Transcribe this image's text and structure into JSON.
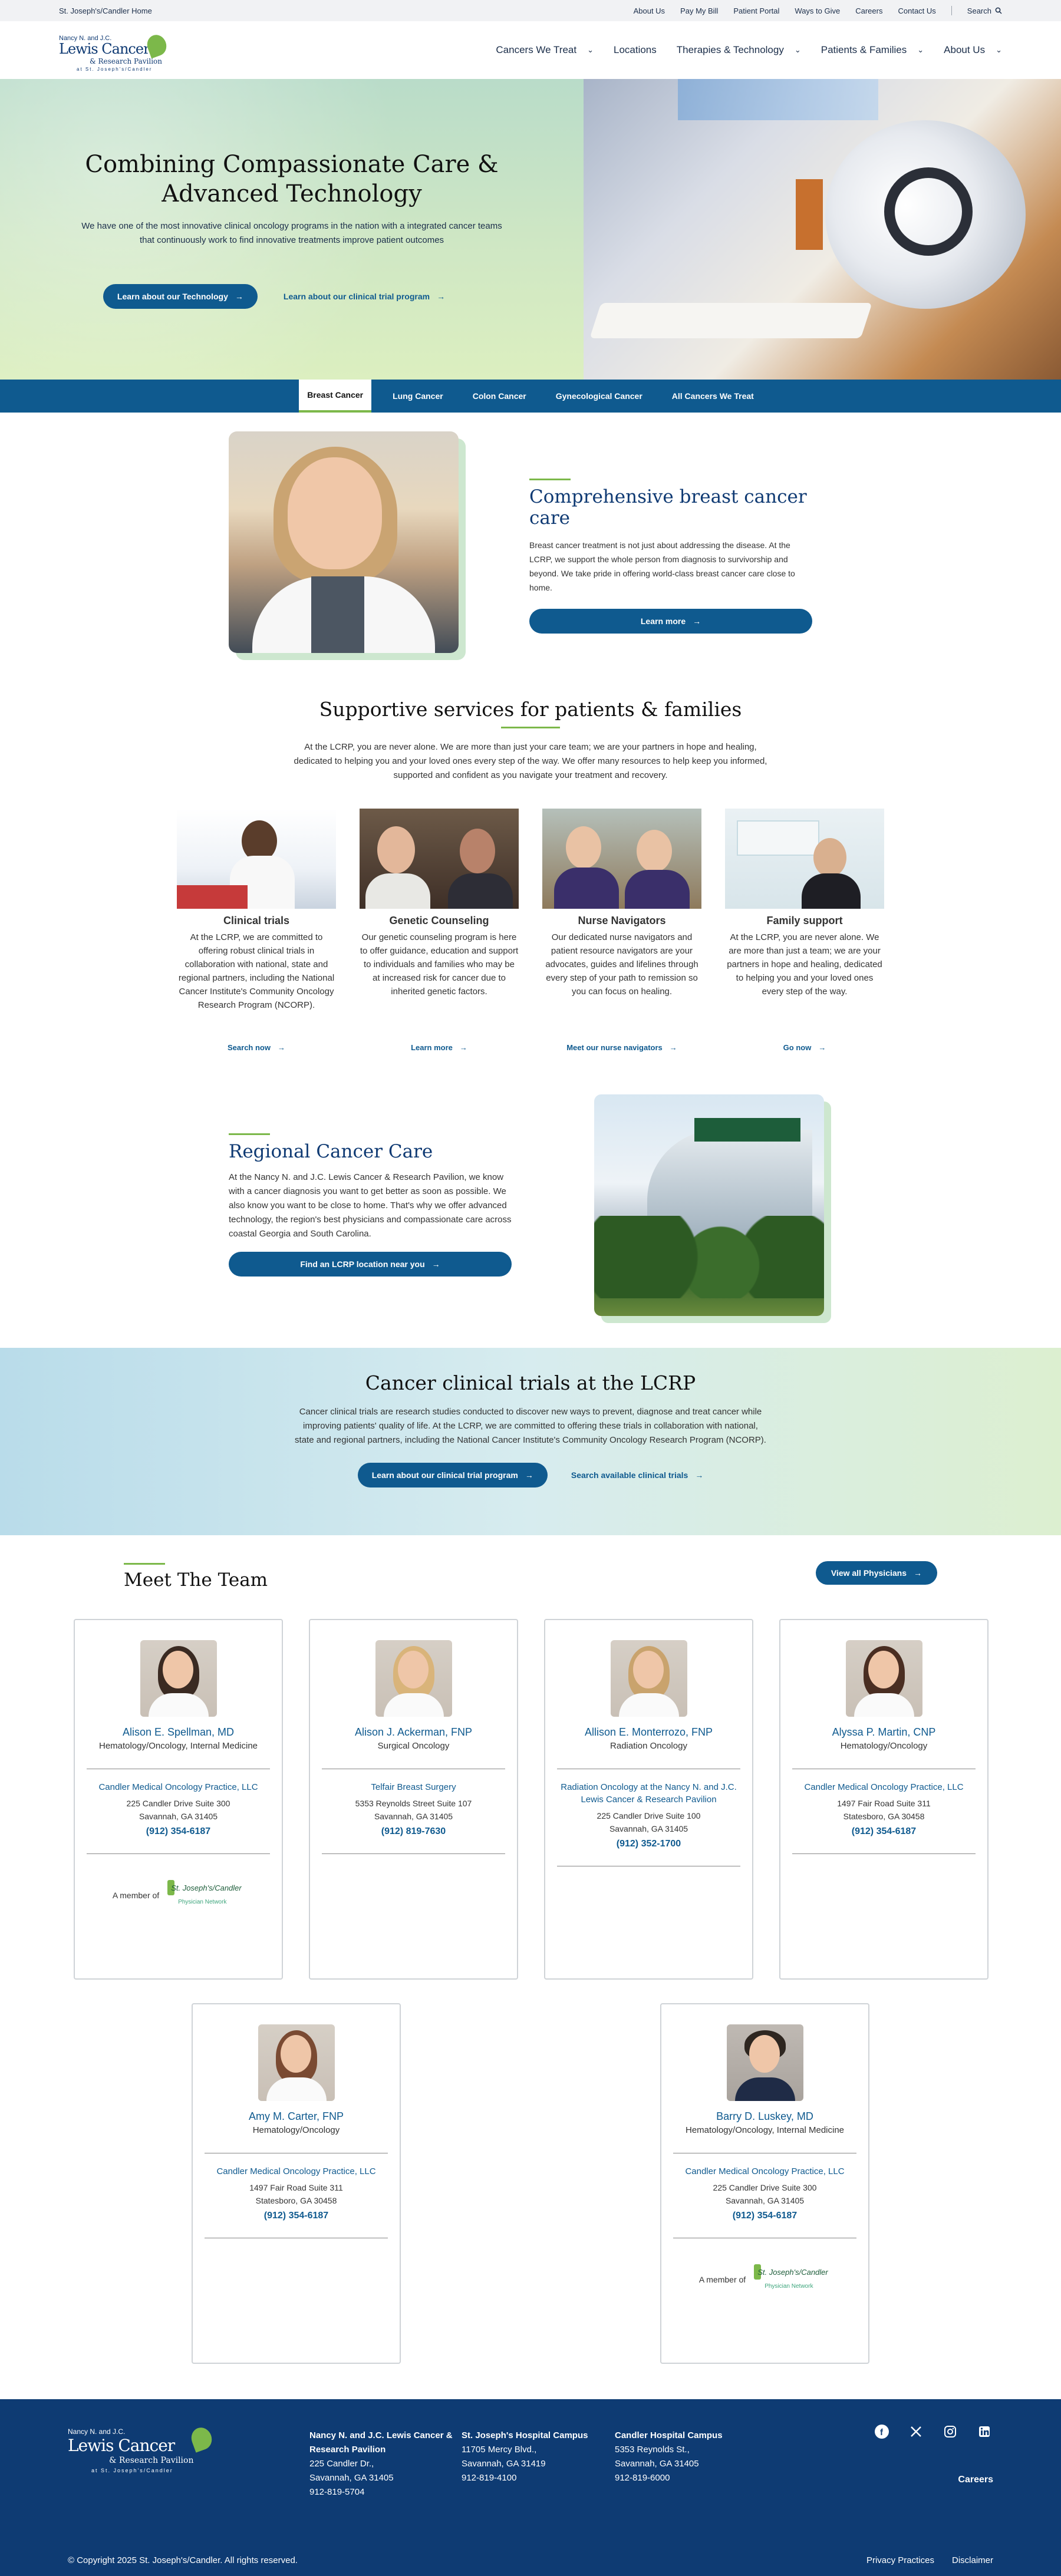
{
  "utility": {
    "home": "St. Joseph's/Candler Home",
    "links": [
      "About Us",
      "Pay My Bill",
      "Patient Portal",
      "Ways to Give",
      "Careers",
      "Contact Us"
    ],
    "search": "Search"
  },
  "logo": {
    "line1": "Nancy N. and J.C.",
    "line2": "Lewis Cancer",
    "line3": "& Research Pavilion",
    "line4": "at St. Joseph's/Candler"
  },
  "nav": [
    "Cancers We Treat",
    "Locations",
    "Therapies & Technology",
    "Patients & Families",
    "About Us"
  ],
  "hero": {
    "title": "Combining Compassionate Care & Advanced Technology",
    "text": "We have one of the most innovative clinical oncology programs in the nation with a integrated cancer teams that continuously work to find innovative treatments improve patient outcomes",
    "cta_primary": "Learn about our Technology",
    "cta_secondary": "Learn about our clinical trial program"
  },
  "tabs": [
    "Breast Cancer",
    "Lung Cancer",
    "Colon Cancer",
    "Gynecological Cancer",
    "All Cancers We Treat"
  ],
  "featured": {
    "title": "Comprehensive breast cancer care",
    "text": "Breast cancer treatment is not just about addressing the disease. At the LCRP, we support the whole person from diagnosis to survivorship and beyond. We take pride in offering world-class breast cancer care close to home.",
    "cta": "Learn more"
  },
  "supportive": {
    "title": "Supportive services for patients & families",
    "intro": "At the LCRP, you are never alone. We are more than just your care team; we are your partners in hope and healing, dedicated to helping you and your loved ones every step of the way. We offer many resources to help keep you informed, supported and confident as you navigate your treatment and recovery.",
    "items": [
      {
        "title": "Clinical trials",
        "text": "At the LCRP, we are committed to offering robust clinical trials in collaboration with national, state and regional partners, including the National Cancer Institute's Community Oncology Research Program (NCORP).",
        "link": "Search now"
      },
      {
        "title": "Genetic Counseling",
        "text": "Our genetic counseling program is here to offer guidance, education and support to individuals and families who may be at increased risk for cancer due to inherited genetic factors.",
        "link": "Learn more"
      },
      {
        "title": "Nurse Navigators",
        "text": "Our dedicated nurse navigators and patient resource navigators are your advocates, guides and lifelines through every step of your path to remission so you can focus on healing.",
        "link": "Meet our nurse navigators"
      },
      {
        "title": "Family support",
        "text": "At the LCRP, you are never alone. We are more than just a team; we are your partners in hope and healing, dedicated to helping you and your loved ones every step of the way.",
        "link": "Go now"
      }
    ]
  },
  "regional": {
    "title": "Regional Cancer Care",
    "text": "At the Nancy N. and J.C. Lewis Cancer & Research Pavilion, we know with a cancer diagnosis you want to get better as soon as possible. We also know you want to be close to home. That's why we offer advanced technology, the region's best physicians and compassionate care across coastal Georgia and South Carolina.",
    "cta": "Find an LCRP location near you"
  },
  "trials": {
    "title": "Cancer clinical trials at the LCRP",
    "text": "Cancer clinical trials are research studies conducted to discover new ways to prevent, diagnose and treat cancer while improving patients' quality of life. At the LCRP, we are committed to offering these trials in collaboration with national, state and regional partners, including the National Cancer Institute's Community Oncology Research Program (NCORP).",
    "cta_primary": "Learn about our clinical trial program",
    "cta_secondary": "Search available clinical trials"
  },
  "team": {
    "title": "Meet The Team",
    "view_all": "View all Physicians",
    "member_label": "A member of",
    "network_name": "St. Joseph's/Candler",
    "network_sub": "Physician Network",
    "physicians": [
      {
        "name": "Alison E. Spellman, MD",
        "spec": "Hematology/Oncology, Internal Medicine",
        "practice": "Candler Medical Oncology Practice, LLC",
        "addr1": "225 Candler Drive Suite 300",
        "addr2": "Savannah, GA 31405",
        "phone": "(912) 354-6187",
        "member": true
      },
      {
        "name": "Alison J. Ackerman, FNP",
        "spec": "Surgical Oncology",
        "practice": "Telfair Breast Surgery",
        "addr1": "5353 Reynolds Street Suite 107",
        "addr2": "Savannah, GA 31405",
        "phone": "(912) 819-7630",
        "member": false
      },
      {
        "name": "Allison E. Monterrozo, FNP",
        "spec": "Radiation Oncology",
        "practice": "Radiation Oncology at the Nancy N. and J.C. Lewis Cancer & Research Pavilion",
        "addr1": "225 Candler Drive Suite 100",
        "addr2": "Savannah, GA 31405",
        "phone": "(912) 352-1700",
        "member": false
      },
      {
        "name": "Alyssa P. Martin, CNP",
        "spec": "Hematology/Oncology",
        "practice": "Candler Medical Oncology Practice, LLC",
        "addr1": "1497 Fair Road Suite 311",
        "addr2": "Statesboro, GA 30458",
        "phone": "(912) 354-6187",
        "member": false
      },
      {
        "name": "Amy M. Carter, FNP",
        "spec": "Hematology/Oncology",
        "practice": "Candler Medical Oncology Practice, LLC",
        "addr1": "1497 Fair Road Suite 311",
        "addr2": "Statesboro, GA 30458",
        "phone": "(912) 354-6187",
        "member": false
      },
      {
        "name": "Barry D. Luskey, MD",
        "spec": "Hematology/Oncology, Internal Medicine",
        "practice": "Candler Medical Oncology Practice, LLC",
        "addr1": "225 Candler Drive Suite 300",
        "addr2": "Savannah, GA 31405",
        "phone": "(912) 354-6187",
        "member": true
      }
    ]
  },
  "footer": {
    "cols": [
      {
        "title": "Nancy N. and J.C. Lewis Cancer & Research Pavilion",
        "lines": [
          "225 Candler Dr.,",
          "Savannah, GA 31405",
          "912-819-5704"
        ]
      },
      {
        "title": "St. Joseph's Hospital Campus",
        "lines": [
          "11705 Mercy Blvd.,",
          "Savannah, GA 31419",
          "912-819-4100"
        ]
      },
      {
        "title": "Candler Hospital Campus",
        "lines": [
          "5353 Reynolds St.,",
          "Savannah, GA 31405",
          "912-819-6000"
        ]
      }
    ],
    "careers": "Careers",
    "copyright": "© Copyright 2025 St. Joseph's/Candler. All rights reserved.",
    "privacy": "Privacy Practices",
    "disclaimer": "Disclaimer",
    "social_icons": [
      "facebook-icon",
      "x-icon",
      "instagram-icon",
      "linkedin-icon"
    ]
  },
  "colors": {
    "brand": "#0f5a8f",
    "navy": "#0e3b73",
    "accent": "#7cb84a"
  }
}
